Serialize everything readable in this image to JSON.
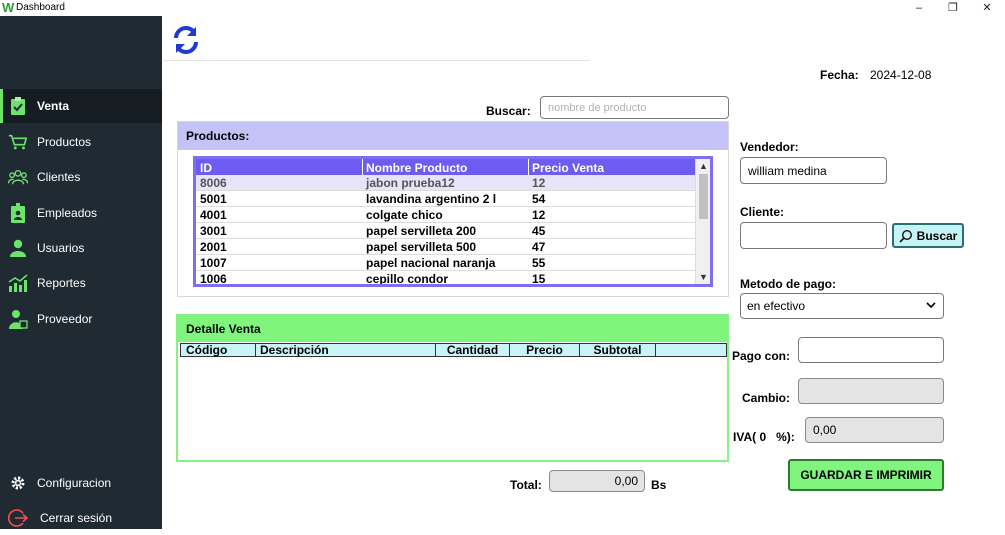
{
  "window": {
    "logo": "W",
    "title": "Dashboard",
    "minimize": "–",
    "restore": "❐",
    "close": "✕"
  },
  "sidebar": {
    "items": [
      {
        "label": "Venta",
        "icon": "clipboard-icon",
        "active": true
      },
      {
        "label": "Productos",
        "icon": "cart-icon"
      },
      {
        "label": "Clientes",
        "icon": "users-group-icon"
      },
      {
        "label": "Empleados",
        "icon": "badge-icon"
      },
      {
        "label": "Usuarios",
        "icon": "user-icon"
      },
      {
        "label": "Reportes",
        "icon": "chart-icon"
      },
      {
        "label": "Proveedor",
        "icon": "supplier-icon"
      }
    ],
    "settings_label": "Configuracion",
    "logout_label": "Cerrar sesión"
  },
  "header": {
    "fecha_label": "Fecha:",
    "fecha_value": "2024-12-08"
  },
  "search": {
    "label": "Buscar:",
    "placeholder": "nombre de producto",
    "value": ""
  },
  "products": {
    "title": "Productos:",
    "columns": [
      "ID",
      "Nombre Producto",
      "Precio Venta"
    ],
    "rows": [
      {
        "id": "8006",
        "name": "jabon prueba12",
        "price": "12"
      },
      {
        "id": "5001",
        "name": "lavandina argentino 2 l",
        "price": "54"
      },
      {
        "id": "4001",
        "name": "colgate chico",
        "price": "12"
      },
      {
        "id": "3001",
        "name": "papel servilleta 200",
        "price": "45"
      },
      {
        "id": "2001",
        "name": "papel servilleta 500",
        "price": "47"
      },
      {
        "id": "1007",
        "name": "papel nacional naranja",
        "price": "55"
      },
      {
        "id": "1006",
        "name": "cepillo condor",
        "price": "15"
      }
    ]
  },
  "detail": {
    "title": "Detalle Venta",
    "columns": [
      "Código",
      "Descripción",
      "Cantidad",
      "Precio",
      "Subtotal"
    ]
  },
  "total": {
    "label": "Total:",
    "value": "0,00",
    "currency": "Bs"
  },
  "form": {
    "vendedor_label": "Vendedor:",
    "vendedor_value": "william medina",
    "cliente_label": "Cliente:",
    "cliente_value": "",
    "buscar_button": "Buscar",
    "metodo_label": "Metodo de pago:",
    "metodo_value": "en efectivo",
    "pago_label": "Pago con:",
    "pago_value": "",
    "cambio_label": "Cambio:",
    "cambio_value": "",
    "iva_label": "IVA( 0   %):",
    "iva_value": "0,00",
    "save_button": "GUARDAR E IMPRIMIR"
  },
  "colors": {
    "sidebar_bg": "#1f2a33",
    "accent_green": "#6ee36b",
    "products_header": "#c3c3f7",
    "table_header": "#6e5cf0",
    "detail_header": "#80f57e",
    "refresh_blue": "#1f3bd1"
  }
}
